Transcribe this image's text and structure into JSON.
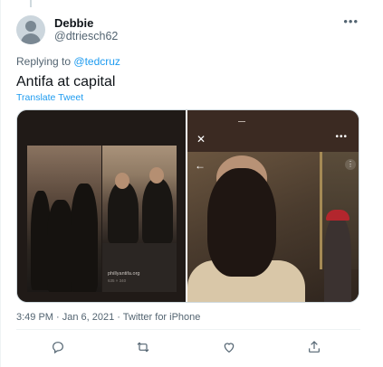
{
  "tweet": {
    "author": {
      "name": "Debbie",
      "handle": "@dtriesch62",
      "more_icon": "more-horizontal-icon"
    },
    "reply": {
      "prefix": "Replying to",
      "mention": "@tedcruz"
    },
    "text": "Antifa at capital",
    "translate_label": "Translate Tweet",
    "media": {
      "left_caption": "phillyantifa.org",
      "left_caption_sub": "635 × 340",
      "right_controls": {
        "close": "close-icon",
        "more": "more-horizontal-icon",
        "back": "back-arrow-icon",
        "options": "more-vertical-icon"
      }
    },
    "meta": "3:49 PM · Jan 6, 2021 · Twitter for iPhone",
    "actions": [
      {
        "name": "reply-icon"
      },
      {
        "name": "retweet-icon"
      },
      {
        "name": "like-icon"
      },
      {
        "name": "share-icon"
      }
    ]
  },
  "colors": {
    "accent": "#1d9bf0",
    "text_secondary": "#536471"
  }
}
